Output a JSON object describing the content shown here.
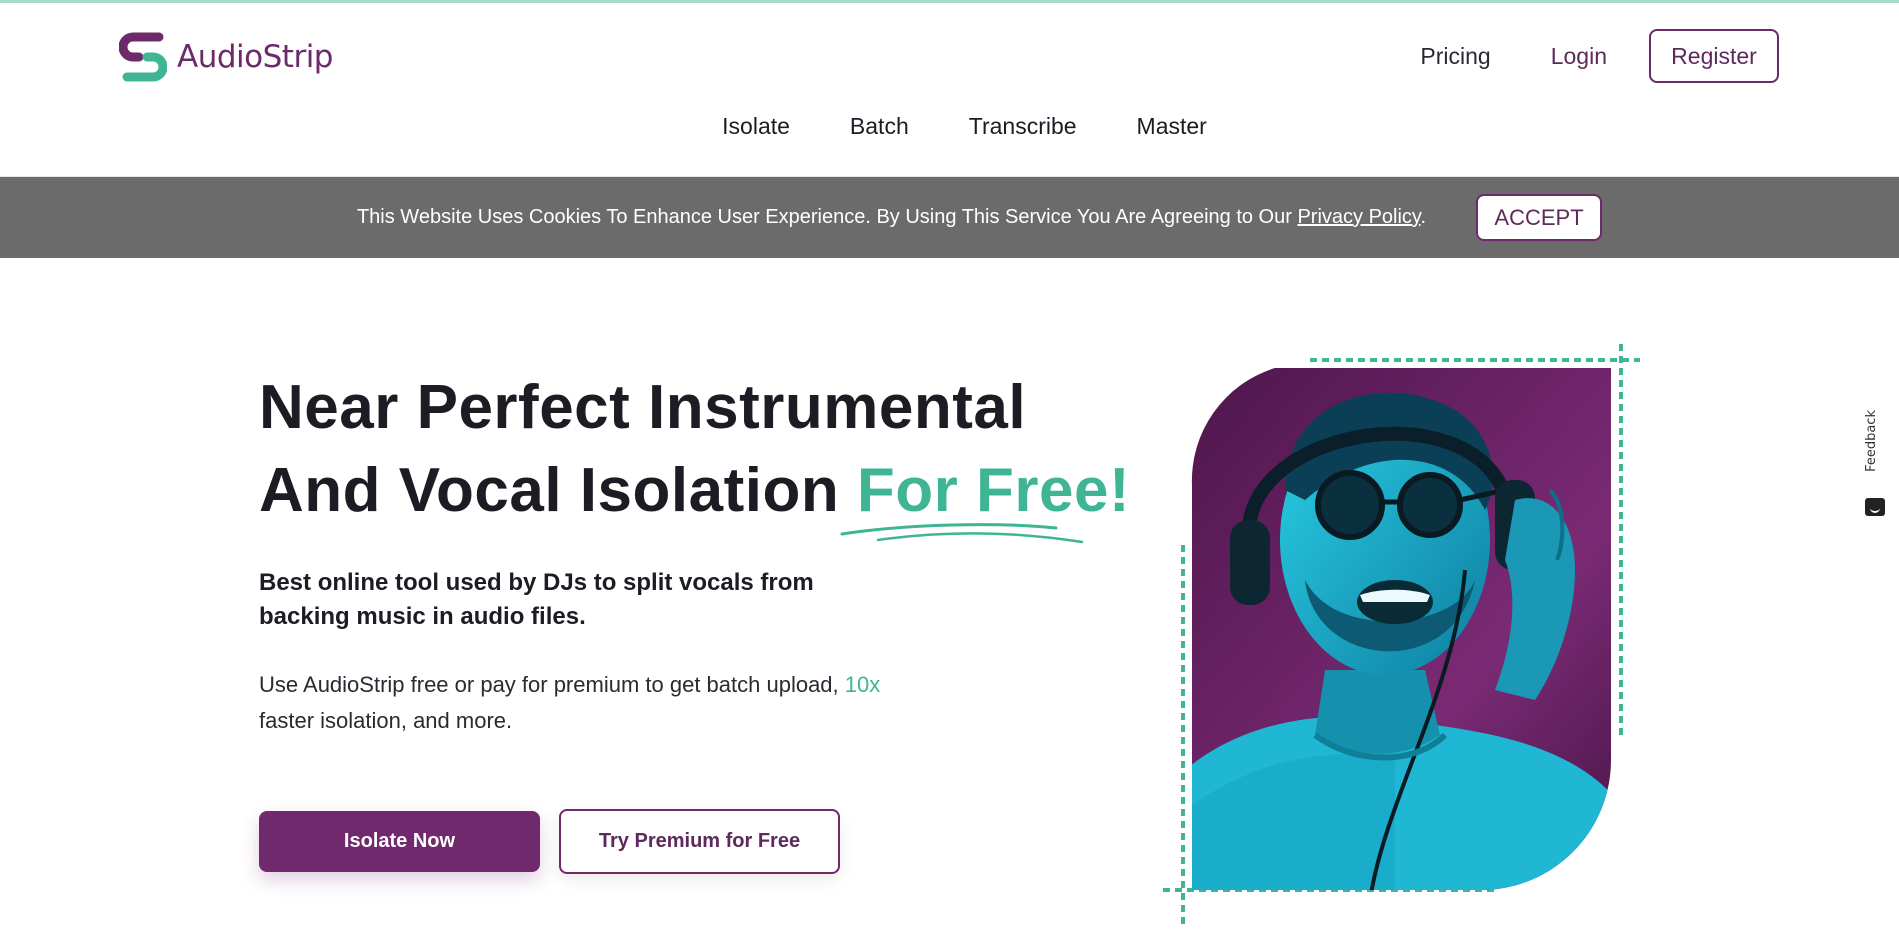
{
  "brand": {
    "name": "AudioStrip",
    "logo_color": "#6d2a6a",
    "logo_accent": "#3fb596"
  },
  "top_nav": {
    "pricing": "Pricing",
    "login": "Login",
    "register": "Register"
  },
  "main_nav": {
    "items": [
      "Isolate",
      "Batch",
      "Transcribe",
      "Master"
    ]
  },
  "cookie_banner": {
    "text": "This Website Uses Cookies To Enhance User Experience. By Using This Service You Are Agreeing to Our ",
    "link": "Privacy Policy",
    "period": ".",
    "accept": "ACCEPT"
  },
  "hero": {
    "title_line1": "Near Perfect Instrumental",
    "title_line2": "And Vocal Isolation ",
    "title_accent": "For Free!",
    "subtitle": "Best online tool used by DJs to split vocals from backing music in audio files.",
    "desc_before": "Use AudioStrip free or pay for premium to get batch upload, ",
    "desc_highlight": "10x",
    "desc_after": " faster isolation, and more.",
    "primary_button": "Isolate Now",
    "secondary_button": "Try Premium for Free"
  },
  "feedback": {
    "label": "Feedback"
  },
  "colors": {
    "primary": "#70296d",
    "accent": "#3fb596",
    "cookie_bg": "#6b6b6b"
  }
}
